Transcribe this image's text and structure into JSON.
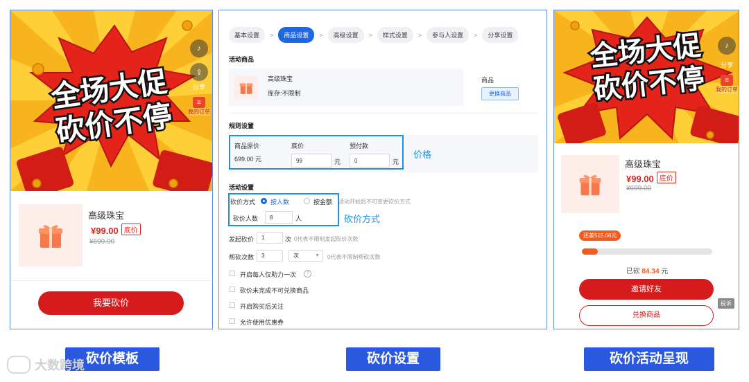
{
  "banner": {
    "line1": "全场大促",
    "line2": "砍价不停",
    "share": "分享",
    "orders": "我的订单"
  },
  "product": {
    "name": "高级珠宝",
    "price": "¥99.00",
    "price_tag": "底价",
    "original": "¥699.00"
  },
  "template_panel": {
    "action_button": "我要砍价"
  },
  "settings": {
    "steps": [
      "基本设置",
      "商品设置",
      "高级设置",
      "样式设置",
      "参与人设置",
      "分享设置"
    ],
    "active_step": 1,
    "activity_goods": {
      "title": "活动商品",
      "name": "高级珠宝",
      "stock": "库存:不限制",
      "goods_label": "商品",
      "change_button": "更换商品"
    },
    "rules": {
      "title": "规则设置",
      "orig_price_label": "商品原价",
      "orig_price_value": "699.00 元",
      "floor_label": "底价",
      "floor_value": "99",
      "deposit_label": "预付款",
      "deposit_value": "0",
      "unit_yuan": "元"
    },
    "activity": {
      "title": "活动设置",
      "mode_label": "砍价方式",
      "mode_by_people": "按人数",
      "mode_by_amount": "按金额",
      "mode_hint": "活动开始后不可变更砍价方式",
      "people_label": "砍价人数",
      "people_value": "8",
      "people_unit": "人",
      "initiate_label": "发起砍价",
      "initiate_value": "1",
      "initiate_unit": "次",
      "initiate_hint": "0代表不限制发起砍价次数",
      "help_label": "帮砍次数",
      "help_value": "3",
      "help_unit": "次",
      "help_hint": "0代表不限制帮砍次数",
      "options": [
        "开启每人仅助力一次",
        "砍价未完成不可兑换商品",
        "开启购买后关注",
        "允许使用优惠券"
      ]
    },
    "annotation_price": "价格",
    "annotation_mode": "砍价方式"
  },
  "result_panel": {
    "remaining_badge": "还差515.66元",
    "progress_fraction": 0.12,
    "cut_prefix": "已砍",
    "cut_amount": "84.34",
    "cut_unit": "元",
    "invite_button": "邀请好友",
    "exchange_button": "兑换商品",
    "report_button": "投诉"
  },
  "captions": [
    "砍价模板",
    "砍价设置",
    "砍价活动呈现"
  ],
  "watermark": "大数跨境",
  "colors": {
    "brand_red": "#d51b1b",
    "accent_blue": "#1e68e6",
    "caption_blue": "#2a59e0"
  }
}
